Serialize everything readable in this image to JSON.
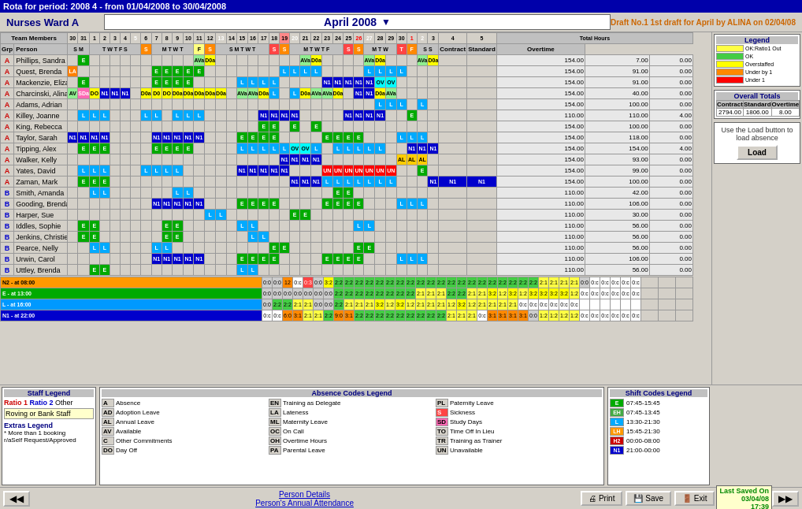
{
  "titleBar": {
    "text": "Rota for period: 2008 4 - from 01/04/2008 to 30/04/2008"
  },
  "header": {
    "wardName": "Nurses Ward A",
    "month": "April 2008",
    "draftInfo": "Draft No.1 1st draft for April by ALINA on 02/04/08"
  },
  "teamMembers": {
    "label": "Team Members",
    "days": [
      "30",
      "31",
      "1",
      "2",
      "3",
      "4",
      "5",
      "6",
      "7",
      "8",
      "9",
      "10",
      "11",
      "12",
      "13",
      "14",
      "15",
      "16",
      "17",
      "18",
      "19",
      "20",
      "21",
      "22",
      "23",
      "24",
      "25",
      "26",
      "27",
      "28",
      "29",
      "30",
      "1",
      "2",
      "3",
      "4",
      "5"
    ]
  },
  "columnHeaders": {
    "grp": "Grp",
    "person": "Person",
    "totalHours": "Total Hours",
    "contract": "Contract",
    "standard": "Standard",
    "overtime": "Overtime"
  },
  "people": [
    {
      "grp": "A",
      "name": "Phillips, Sandra",
      "days": [
        "",
        "E",
        "",
        "",
        "",
        "",
        "",
        "",
        "",
        "",
        "",
        "",
        "AVa",
        "D0a",
        "",
        "",
        "",
        "",
        "",
        "",
        "",
        "",
        "AVa",
        "D0a",
        "",
        "",
        "",
        "",
        "AVa",
        "D0a",
        "",
        "",
        "",
        "AVa",
        "D0a",
        "",
        ""
      ],
      "contract": "154.00",
      "standard": "7.00",
      "overtime": "0.00"
    },
    {
      "grp": "A",
      "name": "Quest, Brenda",
      "days": [
        "LA",
        "",
        "",
        "",
        "",
        "",
        "",
        "",
        "E",
        "E",
        "E",
        "E",
        "E",
        "",
        "",
        "",
        "",
        "",
        "",
        "",
        "L",
        "L",
        "L",
        "L",
        "",
        "",
        "",
        "",
        "L",
        "L",
        "L",
        "L",
        "",
        "",
        "",
        "",
        ""
      ],
      "contract": "154.00",
      "standard": "91.00",
      "overtime": "0.00"
    },
    {
      "grp": "A",
      "name": "Mackenzie, Eliza",
      "days": [
        "",
        "E",
        "",
        "",
        "",
        "",
        "",
        "",
        "E",
        "E",
        "E",
        "E",
        "",
        "",
        "",
        "",
        "L",
        "L",
        "L",
        "L",
        "",
        "",
        "",
        "",
        "N1",
        "N1",
        "N1",
        "N1",
        "N1",
        "OV",
        "OV",
        "",
        "",
        "",
        "",
        "",
        ""
      ],
      "contract": "154.00",
      "standard": "91.00",
      "overtime": "0.00"
    },
    {
      "grp": "A",
      "name": "Charcinski, Alina",
      "days": [
        "AV",
        "SDa",
        "DO",
        "N1",
        "N1",
        "N1",
        "",
        "D0a",
        "D0",
        "DO",
        "D0a",
        "D0a",
        "D0a",
        "D0a",
        "D0a",
        "",
        "AVa",
        "AVa",
        "D0a",
        "L",
        "",
        "L",
        "D0a",
        "AVa",
        "AVa",
        "D0a",
        "",
        "N1",
        "N1",
        "D0a",
        "AVa",
        "",
        "",
        "",
        "",
        "",
        ""
      ],
      "contract": "154.00",
      "standard": "40.00",
      "overtime": "0.00"
    },
    {
      "grp": "A",
      "name": "Adams, Adrian",
      "days": [
        "",
        "",
        "",
        "",
        "",
        "",
        "",
        "",
        "",
        "",
        "",
        "",
        "",
        "",
        "",
        "",
        "",
        "",
        "",
        "",
        "",
        "",
        "",
        "",
        "",
        "",
        "",
        "",
        "",
        "L",
        "L",
        "L",
        "",
        "L",
        "",
        "",
        ""
      ],
      "contract": "154.00",
      "standard": "100.00",
      "overtime": "0.00"
    },
    {
      "grp": "A",
      "name": "Killey, Joanne",
      "days": [
        "",
        "L",
        "L",
        "L",
        "",
        "",
        "",
        "L",
        "L",
        "",
        "L",
        "L",
        "L",
        "",
        "",
        "",
        "",
        "",
        "N1",
        "N1",
        "N1",
        "N1",
        "",
        "",
        "",
        "",
        "N1",
        "N1",
        "N1",
        "N1",
        "",
        "",
        "E",
        "",
        "",
        "",
        ""
      ],
      "contract": "110.00",
      "standard": "110.00",
      "overtime": "4.00"
    },
    {
      "grp": "A",
      "name": "King, Rebecca",
      "days": [
        "",
        "",
        "",
        "",
        "",
        "",
        "",
        "",
        "",
        "",
        "",
        "",
        "",
        "",
        "",
        "",
        "",
        "",
        "E",
        "E",
        "",
        "E",
        "",
        "E",
        "",
        "",
        "",
        "",
        "",
        "",
        "",
        "",
        "",
        "",
        "",
        "",
        ""
      ],
      "contract": "154.00",
      "standard": "100.00",
      "overtime": "0.00"
    },
    {
      "grp": "A",
      "name": "Taylor, Sarah",
      "days": [
        "N1",
        "N1",
        "N1",
        "N1",
        "",
        "",
        "",
        "",
        "N1",
        "N1",
        "N1",
        "N1",
        "N1",
        "",
        "",
        "",
        "E",
        "E",
        "E",
        "E",
        "",
        "",
        "",
        "",
        "E",
        "E",
        "E",
        "E",
        "",
        "",
        "",
        "L",
        "L",
        "L",
        "",
        "",
        ""
      ],
      "contract": "154.00",
      "standard": "118.00",
      "overtime": "0.00"
    },
    {
      "grp": "A",
      "name": "Tipping, Alex",
      "days": [
        "",
        "E",
        "E",
        "E",
        "",
        "",
        "",
        "",
        "E",
        "E",
        "E",
        "E",
        "",
        "",
        "",
        "",
        "L",
        "L",
        "L",
        "L",
        "L",
        "OV",
        "OV",
        "L",
        "",
        "L",
        "L",
        "L",
        "L",
        "L",
        "",
        "",
        "N1",
        "N1",
        "N1",
        "",
        ""
      ],
      "contract": "154.00",
      "standard": "154.00",
      "overtime": "4.00"
    },
    {
      "grp": "A",
      "name": "Walker, Kelly",
      "days": [
        "",
        "",
        "",
        "",
        "",
        "",
        "",
        "",
        "",
        "",
        "",
        "",
        "",
        "",
        "",
        "",
        "",
        "",
        "",
        "",
        "N1",
        "N1",
        "N1",
        "N1",
        "",
        "",
        "",
        "",
        "",
        "",
        "",
        "AL",
        "AL",
        "AL",
        "",
        "",
        ""
      ],
      "contract": "154.00",
      "standard": "93.00",
      "overtime": "0.00"
    },
    {
      "grp": "A",
      "name": "Yates, David",
      "days": [
        "",
        "L",
        "L",
        "L",
        "",
        "",
        "",
        "L",
        "L",
        "L",
        "L",
        "",
        "",
        "",
        "",
        "",
        "N1",
        "N1",
        "N1",
        "N1",
        "N1",
        "",
        "",
        "",
        "UN",
        "UN",
        "UN",
        "UN",
        "UN",
        "UN",
        "UN",
        "",
        "",
        "E",
        "",
        "",
        ""
      ],
      "contract": "154.00",
      "standard": "99.00",
      "overtime": "0.00"
    },
    {
      "grp": "A",
      "name": "Zaman, Mark",
      "days": [
        "",
        "E",
        "E",
        "E",
        "",
        "",
        "",
        "",
        "",
        "",
        "",
        "",
        "",
        "",
        "",
        "",
        "",
        "",
        "",
        "",
        "",
        "N1",
        "N1",
        "N1",
        "L",
        "L",
        "L",
        "L",
        "L",
        "L",
        "L",
        "",
        "",
        "",
        "N1",
        "N1",
        "N1"
      ],
      "contract": "154.00",
      "standard": "100.00",
      "overtime": "0.00"
    },
    {
      "grp": "B",
      "name": "Smith, Amanda",
      "days": [
        "",
        "",
        "L",
        "L",
        "",
        "",
        "",
        "",
        "",
        "",
        "L",
        "L",
        "",
        "",
        "",
        "",
        "",
        "",
        "",
        "",
        "",
        "",
        "",
        "",
        "",
        "E",
        "E",
        "",
        "",
        "",
        "",
        "",
        "",
        "",
        "",
        "",
        ""
      ],
      "contract": "110.00",
      "standard": "42.00",
      "overtime": "0.00"
    },
    {
      "grp": "B",
      "name": "Gooding, Brenda",
      "days": [
        "",
        "",
        "",
        "",
        "",
        "",
        "",
        "",
        "N1",
        "N1",
        "N1",
        "N1",
        "N1",
        "",
        "",
        "",
        "E",
        "E",
        "E",
        "E",
        "",
        "",
        "",
        "",
        "E",
        "E",
        "E",
        "E",
        "",
        "",
        "",
        "L",
        "L",
        "L",
        "",
        "",
        ""
      ],
      "contract": "110.00",
      "standard": "106.00",
      "overtime": "0.00"
    },
    {
      "grp": "B",
      "name": "Harper, Sue",
      "days": [
        "",
        "",
        "",
        "",
        "",
        "",
        "",
        "",
        "",
        "",
        "",
        "",
        "",
        "L",
        "L",
        "",
        "",
        "",
        "",
        "",
        "",
        "E",
        "E",
        "",
        "",
        "",
        "",
        "",
        "",
        "",
        "",
        "",
        "",
        "",
        "",
        "",
        ""
      ],
      "contract": "110.00",
      "standard": "30.00",
      "overtime": "0.00"
    },
    {
      "grp": "B",
      "name": "Iddles, Sophie",
      "days": [
        "",
        "E",
        "E",
        "",
        "",
        "",
        "",
        "",
        "",
        "E",
        "E",
        "",
        "",
        "",
        "",
        "",
        "L",
        "L",
        "",
        "",
        "",
        "",
        "",
        "",
        "",
        "",
        "",
        "L",
        "L",
        "",
        "",
        "",
        "",
        "",
        "",
        "",
        ""
      ],
      "contract": "110.00",
      "standard": "56.00",
      "overtime": "0.00"
    },
    {
      "grp": "B",
      "name": "Jenkins, Christie",
      "days": [
        "",
        "E",
        "E",
        "",
        "",
        "",
        "",
        "",
        "",
        "E",
        "E",
        "",
        "",
        "",
        "",
        "",
        "",
        "L",
        "L",
        "",
        "",
        "",
        "",
        "",
        "",
        "",
        "",
        "",
        "",
        "",
        "",
        "",
        "",
        "",
        "",
        "",
        ""
      ],
      "contract": "110.00",
      "standard": "56.00",
      "overtime": "0.00"
    },
    {
      "grp": "B",
      "name": "Pearce, Nelly",
      "days": [
        "",
        "",
        "L",
        "L",
        "",
        "",
        "",
        "",
        "L",
        "L",
        "",
        "",
        "",
        "",
        "",
        "",
        "",
        "",
        "",
        "E",
        "E",
        "",
        "",
        "",
        "",
        "",
        "",
        "E",
        "E",
        "",
        "",
        "",
        "",
        "",
        "",
        "",
        ""
      ],
      "contract": "110.00",
      "standard": "56.00",
      "overtime": "0.00"
    },
    {
      "grp": "B",
      "name": "Urwin, Carol",
      "days": [
        "",
        "",
        "",
        "",
        "",
        "",
        "",
        "",
        "N1",
        "N1",
        "N1",
        "N1",
        "N1",
        "",
        "",
        "",
        "E",
        "E",
        "E",
        "E",
        "",
        "",
        "",
        "",
        "E",
        "E",
        "E",
        "E",
        "",
        "",
        "",
        "L",
        "L",
        "L",
        "",
        "",
        ""
      ],
      "contract": "110.00",
      "standard": "106.00",
      "overtime": "0.00"
    },
    {
      "grp": "B",
      "name": "Uttley, Brenda",
      "days": [
        "",
        "",
        "E",
        "E",
        "",
        "",
        "",
        "",
        "",
        "",
        "",
        "",
        "",
        "",
        "",
        "",
        "L",
        "L",
        "",
        "",
        "",
        "",
        "",
        "",
        "",
        "",
        "",
        "",
        "",
        "",
        "",
        "",
        "",
        "",
        "",
        "",
        ""
      ],
      "contract": "110.00",
      "standard": "56.00",
      "overtime": "0.00"
    }
  ],
  "summaryRows": [
    {
      "label": "N2 - at 08:00",
      "color": "sumrow-n2",
      "values": [
        "0:0",
        "0:0",
        "12",
        "0:c",
        "0:3",
        "0:0",
        "3:2",
        "2:2",
        "2:2",
        "2:2",
        "2:2",
        "2:2",
        "2:2",
        "2:2",
        "2:2",
        "2:2",
        "2:2",
        "2:2",
        "2:2",
        "2:2",
        "2:2",
        "2:2",
        "2:2",
        "2:2",
        "2:2",
        "2:2",
        "2:2",
        "2:1",
        "2:1",
        "2:1",
        "2:1",
        "0:0",
        "0:c",
        "0:c",
        "0:c",
        "0:c",
        "0:c"
      ]
    },
    {
      "label": "E - at 13:00",
      "color": "sumrow-e",
      "values": [
        "0:0",
        "0:0",
        "0:0",
        "0:0",
        "0:0",
        "0:0",
        "0:0",
        "2:2",
        "2:2",
        "2:2",
        "2:2",
        "2:2",
        "2:2",
        "2:2",
        "2:2",
        "2:1",
        "2:1",
        "2:1",
        "2:2",
        "2:2",
        "2:1",
        "2:1",
        "3:2",
        "1:2",
        "3:2",
        "1:2",
        "3:2",
        "3:2",
        "3:2",
        "3:2",
        "1:2",
        "0:c",
        "0:c",
        "0:c",
        "0:c",
        "0:c",
        "0:c"
      ]
    },
    {
      "label": "L - at 16:00",
      "color": "sumrow-l",
      "values": [
        "0:0",
        "2:2",
        "2:2",
        "2:1",
        "2:1",
        "0:0",
        "0:0",
        "2:2",
        "2:1",
        "2:1",
        "2:1",
        "3:2",
        "1:2",
        "3:2",
        "1:2",
        "2:1",
        "2:1",
        "2:1",
        "1:2",
        "3:2",
        "1:2",
        "2:1",
        "2:1",
        "2:1",
        "2:1",
        "0:c",
        "0:c",
        "0:c",
        "0:c",
        "0:c",
        "0:c",
        "",
        "",
        "",
        "",
        "",
        ""
      ]
    },
    {
      "label": "N1 - at 22:00",
      "color": "sumrow-n1",
      "values": [
        "0:c",
        "0:c",
        "6:0",
        "3:1",
        "2:1",
        "2:1",
        "2:2",
        "9:0",
        "3:1",
        "2:2",
        "2:2",
        "2:2",
        "2:2",
        "2:2",
        "2:2",
        "2:2",
        "2:2",
        "2:2",
        "2:1",
        "2:1",
        "2:1",
        "0:c",
        "3:1",
        "3:1",
        "3:1",
        "3:1",
        "0:0",
        "1:2",
        "1:2",
        "1:2",
        "1:2",
        "0:c",
        "0:c",
        "0:c",
        "0:c",
        "0:c",
        "0:c"
      ]
    }
  ],
  "legend": {
    "title": "Legend",
    "items": [
      {
        "color": "#ffff44",
        "label": "OK:Ratio1 Out"
      },
      {
        "color": "#44cc44",
        "label": "OK"
      },
      {
        "color": "#ffff00",
        "label": "Overstaffed"
      },
      {
        "color": "#ff8800",
        "label": "Under by 1"
      },
      {
        "color": "#ff0000",
        "label": "Under  1"
      }
    ]
  },
  "staffLegend": {
    "title": "Staff Legend",
    "ratio1": "Ratio 1",
    "ratio2": "Ratio 2",
    "other": "Other",
    "roving": "Roving or Bank Staff"
  },
  "extrasLegend": {
    "title": "Extras Legend",
    "line1": "* More than 1 booking",
    "line2": "r/aSelf Request/Approved"
  },
  "absenceLegend": {
    "title": "Absence Codes Legend",
    "codes": [
      {
        "code": "A",
        "desc": "Absence",
        "col": 1
      },
      {
        "code": "EN",
        "desc": "Training as Delegate",
        "col": 2
      },
      {
        "code": "PL",
        "desc": "Paternity Leave",
        "col": 3
      },
      {
        "code": "AD",
        "desc": "Adoption Leave",
        "col": 1
      },
      {
        "code": "LA",
        "desc": "Lateness",
        "col": 2
      },
      {
        "code": "S",
        "desc": "Sickness",
        "col": 3
      },
      {
        "code": "AL",
        "desc": "Annual Leave",
        "col": 1
      },
      {
        "code": "ML",
        "desc": "Maternity Leave",
        "col": 2
      },
      {
        "code": "SD",
        "desc": "Study Days",
        "col": 3
      },
      {
        "code": "AV",
        "desc": "Available",
        "col": 1
      },
      {
        "code": "OC",
        "desc": "On Call",
        "col": 2
      },
      {
        "code": "TO",
        "desc": "Time Off In Lieu",
        "col": 3
      },
      {
        "code": "C",
        "desc": "Other Commitments",
        "col": 1
      },
      {
        "code": "OH",
        "desc": "Overtime Hours",
        "col": 2
      },
      {
        "code": "TR",
        "desc": "Training as Trainer",
        "col": 3
      },
      {
        "code": "DO",
        "desc": "Day Off",
        "col": 1
      },
      {
        "code": "PA",
        "desc": "Parental Leave",
        "col": 2
      },
      {
        "code": "UN",
        "desc": "Unavailable",
        "col": 3
      }
    ]
  },
  "shiftLegend": {
    "title": "Shift Codes Legend",
    "shifts": [
      {
        "code": "E",
        "color": "#00aa00",
        "time": "07:45-15:45"
      },
      {
        "code": "EH",
        "color": "#44aa44",
        "time": "07:45-13:45"
      },
      {
        "code": "L",
        "color": "#00aaff",
        "time": "13:30-21:30"
      },
      {
        "code": "LH",
        "color": "#ff9900",
        "time": "15:45-21:30"
      },
      {
        "code": "H2",
        "color": "#cc0000",
        "time": "00:00-08:00"
      },
      {
        "code": "N1",
        "color": "#0000cc",
        "time": "21:00-00:00"
      }
    ]
  },
  "overallTotals": {
    "title": "Overall Totals",
    "contract": "2794.00",
    "standard": "1806.00",
    "overtime": "8.00"
  },
  "loadArea": {
    "text": "Use the Load button to load absence",
    "buttonLabel": "Load"
  },
  "footer": {
    "personDetails": "Person Details",
    "annualAttendance": "Person's Annual Attendance",
    "print": "Print",
    "save": "Save",
    "exit": "Exit",
    "lastSavedLabel": "Last Saved On",
    "lastSavedDate": "03/04/08",
    "lastSavedTime": "17:39"
  }
}
